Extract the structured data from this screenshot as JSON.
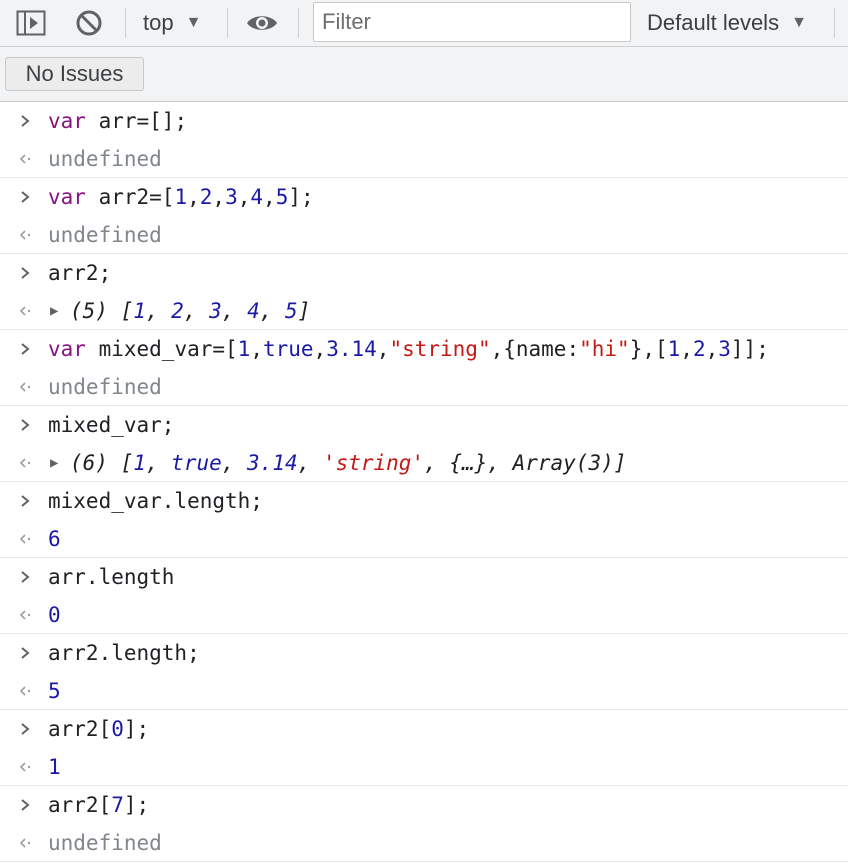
{
  "toolbar": {
    "context": "top",
    "filter_placeholder": "Filter",
    "levels": "Default levels"
  },
  "issues_button": "No Issues",
  "icons": [
    "sidebar-toggle-icon",
    "clear-console-icon",
    "eye-icon",
    "chevron-right-icon",
    "return-arrow-icon",
    "expand-triangle-icon"
  ],
  "colors": {
    "keyword": "#881280",
    "number": "#1a1aa6",
    "string": "#c41a16",
    "undefined": "#80868b"
  },
  "entries": [
    {
      "input": [
        "var",
        " arr=[];"
      ],
      "output": "undefined"
    },
    {
      "input": [
        "var",
        " arr2=[",
        "1",
        ",",
        "2",
        ",",
        "3",
        ",",
        "4",
        ",",
        "5",
        "];"
      ],
      "output": "undefined"
    },
    {
      "input": "arr2;",
      "output": [
        "(5) [",
        "1",
        ", ",
        "2",
        ", ",
        "3",
        ", ",
        "4",
        ", ",
        "5",
        "]"
      ]
    },
    {
      "input": [
        "var",
        " mixed_var=[",
        "1",
        ",",
        "true",
        ",",
        "3.14",
        ",",
        "\"string\"",
        ",{name:",
        "\"hi\"",
        "},[",
        "1",
        ",",
        "2",
        ",",
        "3",
        "]];"
      ],
      "output": "undefined"
    },
    {
      "input": "mixed_var;",
      "output": [
        "(6) [",
        "1",
        ", ",
        "true",
        ", ",
        "3.14",
        ", ",
        "'string'",
        ", {…}, Array(3)]"
      ]
    },
    {
      "input": "mixed_var.length;",
      "output": "6"
    },
    {
      "input": "arr.length",
      "output": "0"
    },
    {
      "input": "arr2.length;",
      "output": "5"
    },
    {
      "input": [
        "arr2[",
        "0",
        "];"
      ],
      "output": "1"
    },
    {
      "input": [
        "arr2[",
        "7",
        "];"
      ],
      "output": "undefined"
    }
  ]
}
